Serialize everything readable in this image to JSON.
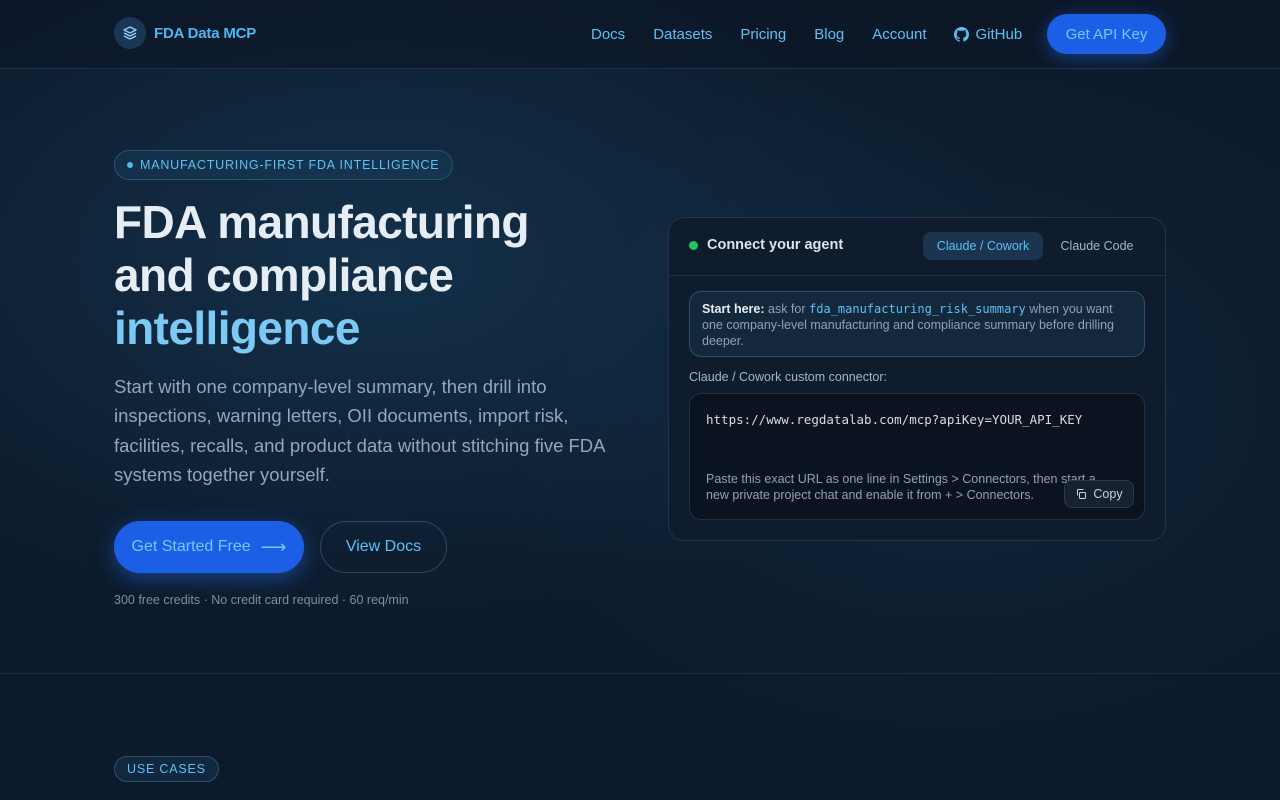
{
  "nav": {
    "brand": "FDA Data MCP",
    "logo_icon": "layers-icon",
    "links": [
      {
        "label": "Docs"
      },
      {
        "label": "Datasets"
      },
      {
        "label": "Pricing"
      },
      {
        "label": "Blog"
      },
      {
        "label": "Account"
      },
      {
        "label": "GitHub",
        "icon": "github-icon"
      }
    ],
    "cta": "Get API Key"
  },
  "hero": {
    "badge": "MANUFACTURING-FIRST FDA INTELLIGENCE",
    "title_line1": "FDA manufacturing",
    "title_line2": "and compliance",
    "title_accent": "intelligence",
    "subtitle": "Start with one company-level summary, then drill into inspections, warning letters, OII documents, import risk, facilities, recalls, and product data without stitching five FDA systems together yourself.",
    "primary_cta": "Get Started Free",
    "primary_cta_icon": "arrow-right-icon",
    "secondary_cta": "View Docs",
    "fine_print": "300 free credits · No credit card required · 60 req/min"
  },
  "connect_card": {
    "title": "Connect your agent",
    "status_color": "#22c55e",
    "tabs": [
      {
        "label": "Claude / Cowork",
        "active": true
      },
      {
        "label": "Claude Code",
        "active": false
      }
    ],
    "tip": {
      "lead": "Start here:",
      "pre": " ask for ",
      "code": "fda_manufacturing_risk_summary",
      "post": " when you want one company-level manufacturing and compliance summary before drilling deeper."
    },
    "connector_label": "Claude / Cowork custom connector:",
    "url": "https://www.regdatalab.com/mcp?apiKey=YOUR_API_KEY",
    "note": "Paste this exact URL as one line in Settings > Connectors, then start a new private project chat and enable it from + > Connectors.",
    "copy_label": "Copy",
    "copy_icon": "copy-icon"
  },
  "next_section": {
    "badge": "USE CASES"
  },
  "colors": {
    "accent": "#5cc0f5",
    "primary": "#1c5fe6",
    "background": "#0d1a2b"
  }
}
